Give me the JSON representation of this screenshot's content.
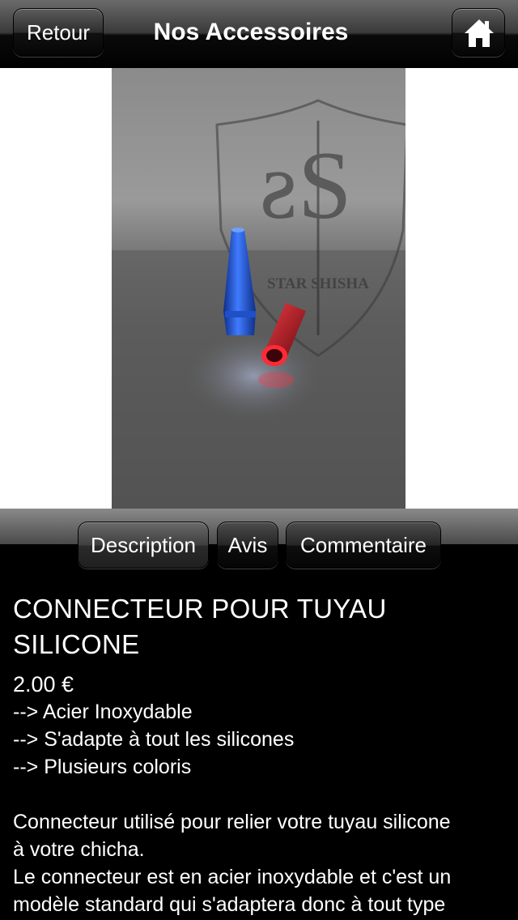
{
  "navbar": {
    "back_label": "Retour",
    "title": "Nos Accessoires",
    "home_icon": "home-icon"
  },
  "product_image": {
    "watermark_text": "STAR SHISHA",
    "watermark_logo": "SS"
  },
  "tabs": [
    {
      "label": "Description",
      "active": true
    },
    {
      "label": "Avis",
      "active": false
    },
    {
      "label": "Commentaire",
      "active": false
    }
  ],
  "product": {
    "title_line1": "CONNECTEUR POUR TUYAU",
    "title_line2": "SILICONE",
    "price": "2.00 €",
    "features": [
      "--> Acier Inoxydable",
      "--> S'adapte à tout les silicones",
      "--> Plusieurs coloris"
    ],
    "description_lines": [
      "Connecteur utilisé pour relier votre tuyau silicone",
      "à votre chicha.",
      "Le connecteur est en acier inoxydable et c'est un",
      "modèle standard qui s'adaptera donc à tout type"
    ]
  },
  "colors": {
    "navbar_bg": "#000000",
    "content_bg": "#000000",
    "text": "#ffffff",
    "connector_blue": "#1f4fd0",
    "connector_red": "#d21f2a"
  }
}
